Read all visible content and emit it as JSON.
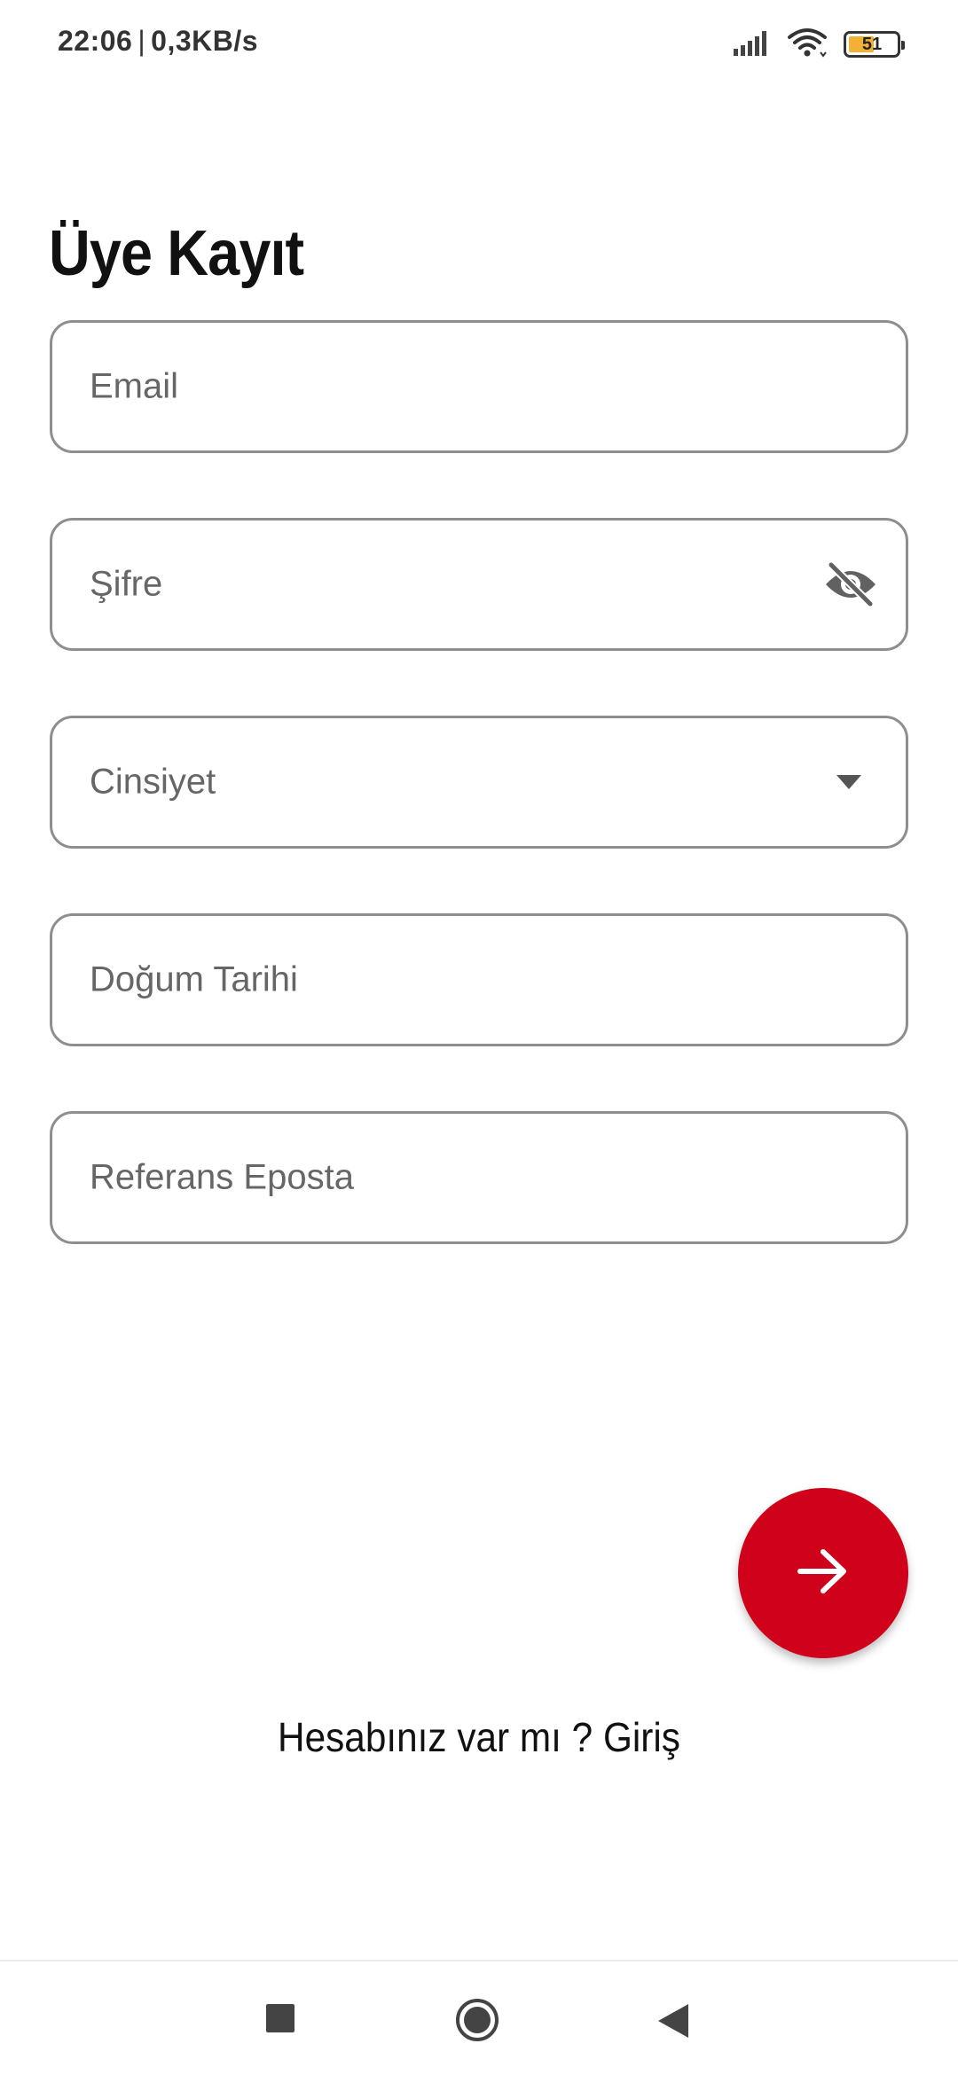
{
  "status_bar": {
    "time": "22:06",
    "network_speed": "0,3KB/s",
    "battery_level": "51",
    "icons": [
      "signal-icon",
      "wifi-icon",
      "battery-icon"
    ]
  },
  "title": "Üye Kayıt",
  "form": {
    "email_label": "Email",
    "password_label": "Şifre",
    "gender_label": "Cinsiyet",
    "birth_date_label": "Doğum Tarihi",
    "referral_label": "Referans Eposta",
    "password_toggle_icon": "eye-off-icon",
    "gender_dropdown_icon": "caret-down-icon"
  },
  "submit_icon": "arrow-right-icon",
  "login_prompt": "Hesabınız var mı ? Giriş",
  "colors": {
    "accent": "#d0021b",
    "field_border": "#8e8e8e",
    "label": "#666666",
    "battery": "#f2b134"
  },
  "nav_bar": {
    "icons": [
      "recent-apps-icon",
      "home-icon",
      "back-icon"
    ]
  }
}
